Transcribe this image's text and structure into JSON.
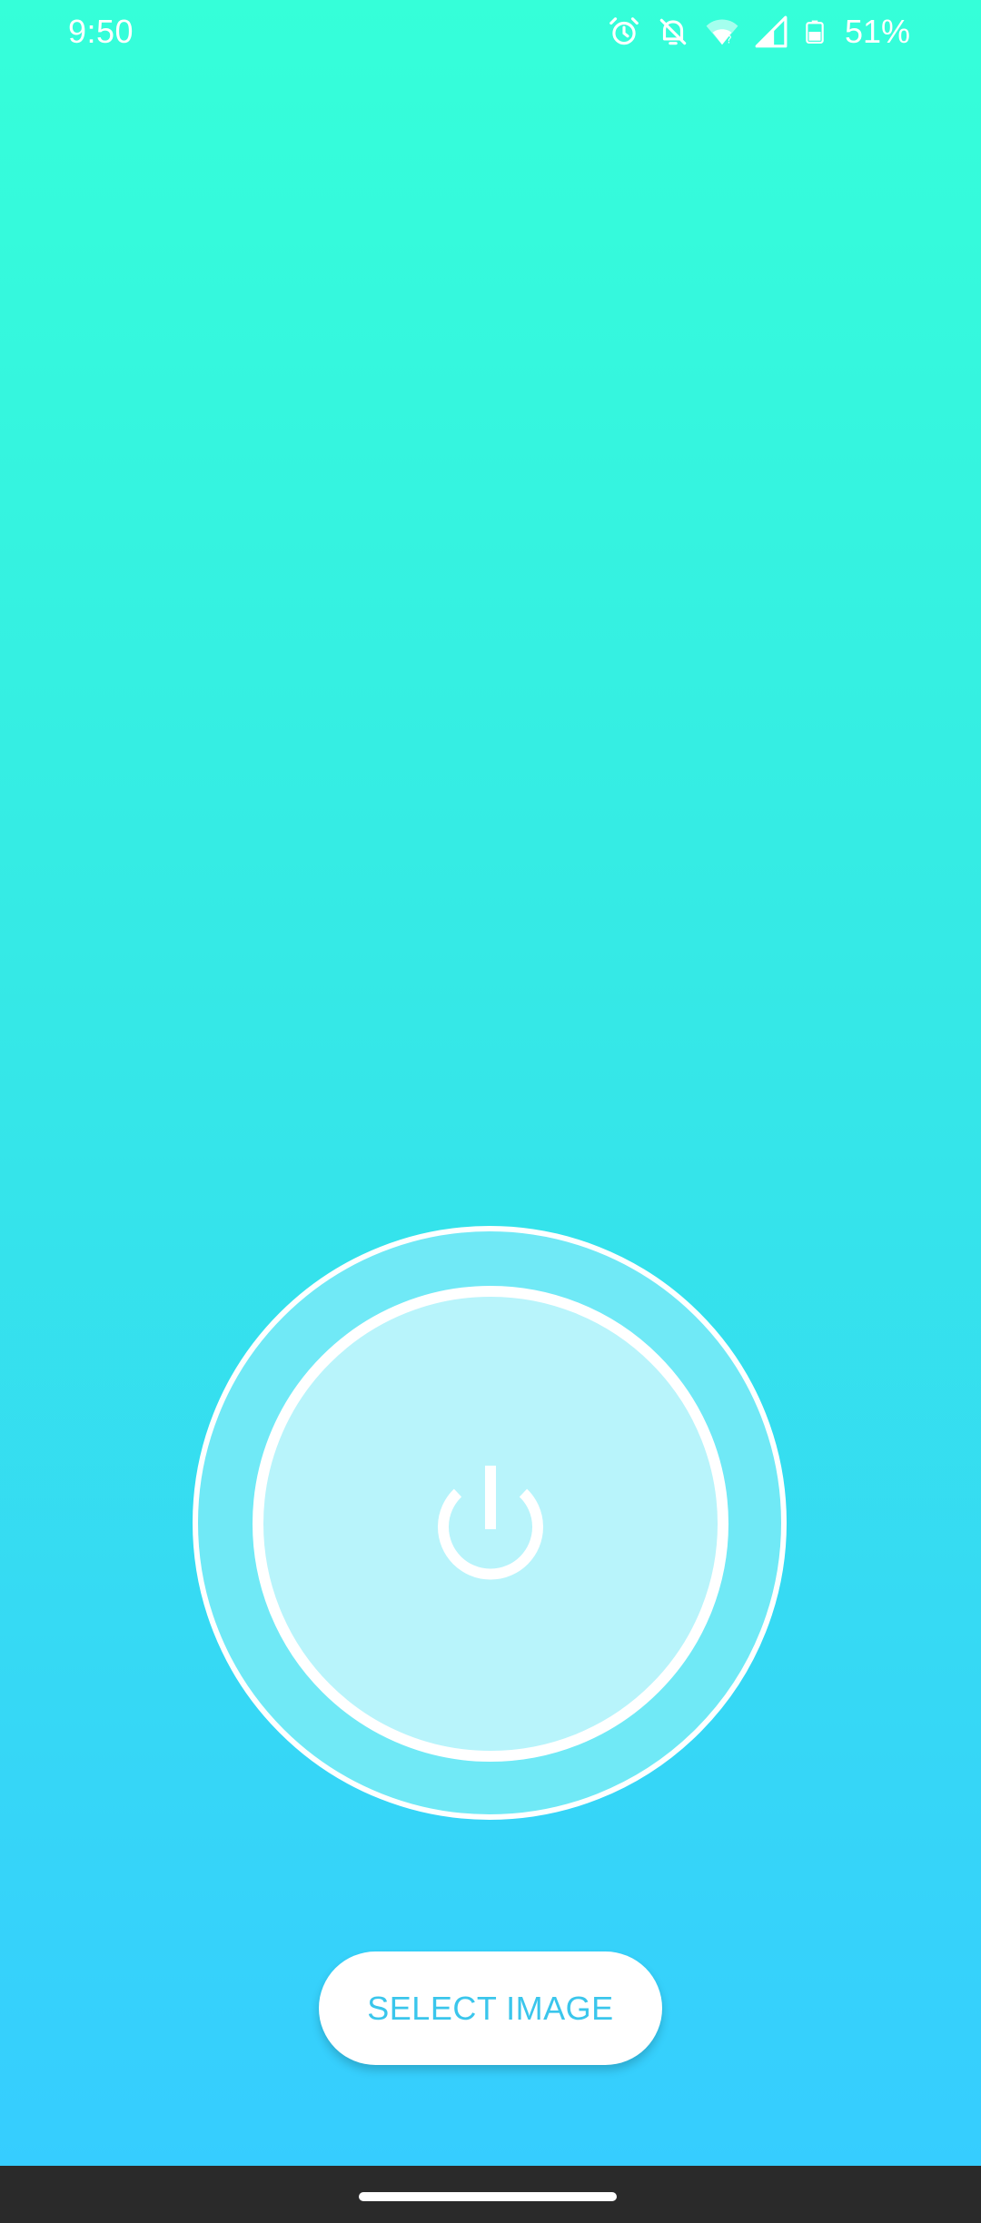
{
  "status_bar": {
    "time": "9:50",
    "battery_percent": "51%",
    "icons": [
      "alarm-icon",
      "notifications-off-icon",
      "wifi-icon",
      "cellular-signal-icon",
      "battery-icon"
    ]
  },
  "main": {
    "power_button": {
      "icon": "power-icon"
    },
    "select_button_label": "SELECT IMAGE"
  },
  "colors": {
    "gradient_top": "#35ffd9",
    "gradient_bottom": "#36cdff",
    "button_text": "#3ac6ec",
    "outer_ring_fill": "#70e9f6",
    "inner_circle_fill": "#b8f4fb",
    "nav_bar": "#2a2a2a"
  }
}
